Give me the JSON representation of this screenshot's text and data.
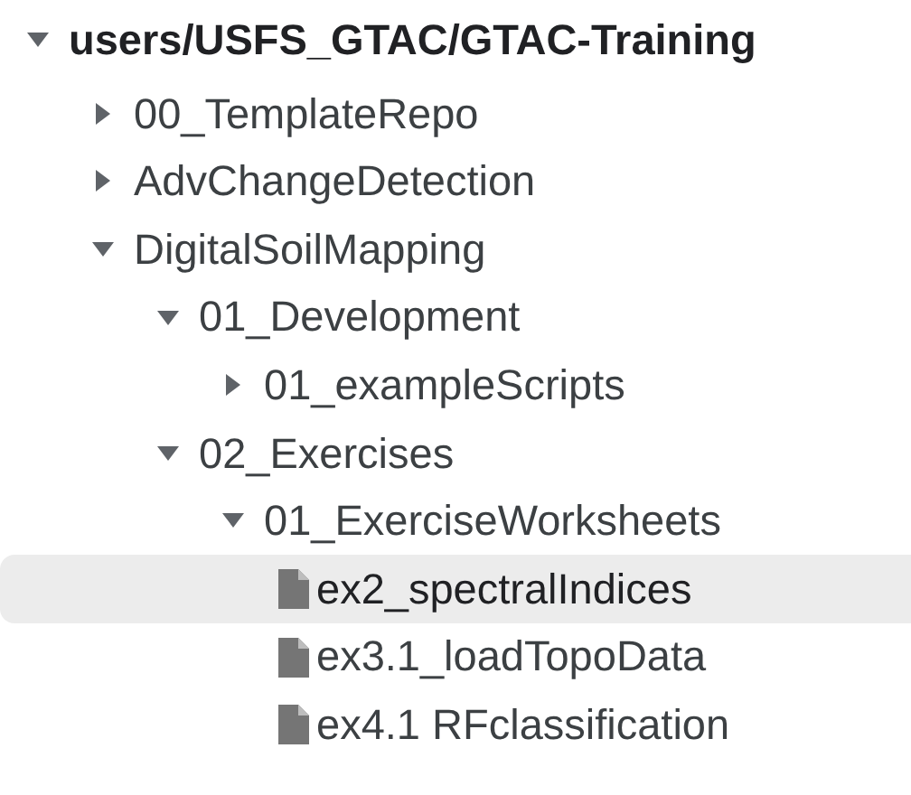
{
  "tree": [
    {
      "label": "users/USFS_GTAC/GTAC-Training",
      "kind": "root",
      "expanded": true,
      "selected": false,
      "children": [
        {
          "label": "00_TemplateRepo",
          "kind": "folder",
          "expanded": false,
          "selected": false
        },
        {
          "label": "AdvChangeDetection",
          "kind": "folder",
          "expanded": false,
          "selected": false
        },
        {
          "label": "DigitalSoilMapping",
          "kind": "folder",
          "expanded": true,
          "selected": false,
          "children": [
            {
              "label": "01_Development",
              "kind": "folder",
              "expanded": true,
              "selected": false,
              "children": [
                {
                  "label": "01_exampleScripts",
                  "kind": "folder",
                  "expanded": false,
                  "selected": false
                }
              ]
            },
            {
              "label": "02_Exercises",
              "kind": "folder",
              "expanded": true,
              "selected": false,
              "children": [
                {
                  "label": "01_ExerciseWorksheets",
                  "kind": "folder",
                  "expanded": true,
                  "selected": false,
                  "children": [
                    {
                      "label": "ex2_spectralIndices",
                      "kind": "file",
                      "selected": true
                    },
                    {
                      "label": "ex3.1_loadTopoData",
                      "kind": "file",
                      "selected": false
                    },
                    {
                      "label": "ex4.1 RFclassification",
                      "kind": "file",
                      "selected": false
                    }
                  ]
                }
              ]
            }
          ]
        }
      ]
    }
  ]
}
